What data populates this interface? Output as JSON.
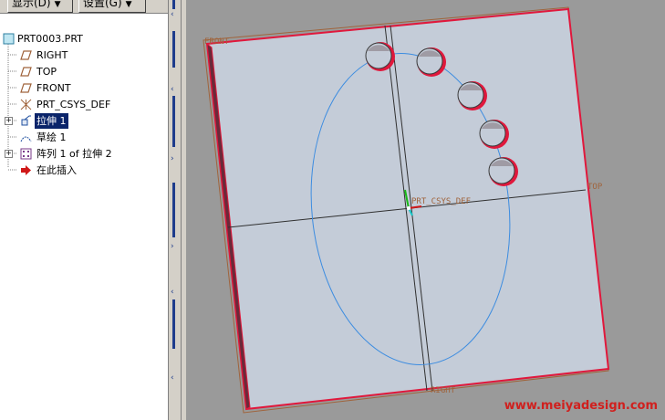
{
  "toolbar": {
    "display_label": "显示(D)",
    "settings_label": "设置(G)"
  },
  "tree": {
    "items": [
      {
        "label": "PRT0003.PRT",
        "icon": "part-icon"
      },
      {
        "label": "RIGHT",
        "icon": "datum-plane-icon"
      },
      {
        "label": "TOP",
        "icon": "datum-plane-icon"
      },
      {
        "label": "FRONT",
        "icon": "datum-plane-icon"
      },
      {
        "label": "PRT_CSYS_DEF",
        "icon": "coordinate-system-icon"
      },
      {
        "label": "拉伸 1",
        "icon": "extrude-icon",
        "selected": true
      },
      {
        "label": "草绘 1",
        "icon": "sketch-icon"
      },
      {
        "label": "阵列 1 of 拉伸 2",
        "icon": "pattern-icon"
      },
      {
        "label": "在此插入",
        "icon": "insert-here-arrow-icon"
      }
    ]
  },
  "viewport": {
    "datum_front_label": "FRONT",
    "datum_top_label": "TOP",
    "datum_right_label": "RIGHT",
    "csys_label": "PRT_CSYS_DEF",
    "watermark": "www.meiyadesign.com"
  },
  "colors": {
    "background": "#9a9a9a",
    "plate_fill": "#c4ccd8",
    "plate_edge": "#e0183c",
    "datum_plane": "#a0643c",
    "ellipse": "#3c8ce0",
    "hole_edge": "#c8284c",
    "selection": "#0a246a",
    "watermark": "#d0201e"
  }
}
